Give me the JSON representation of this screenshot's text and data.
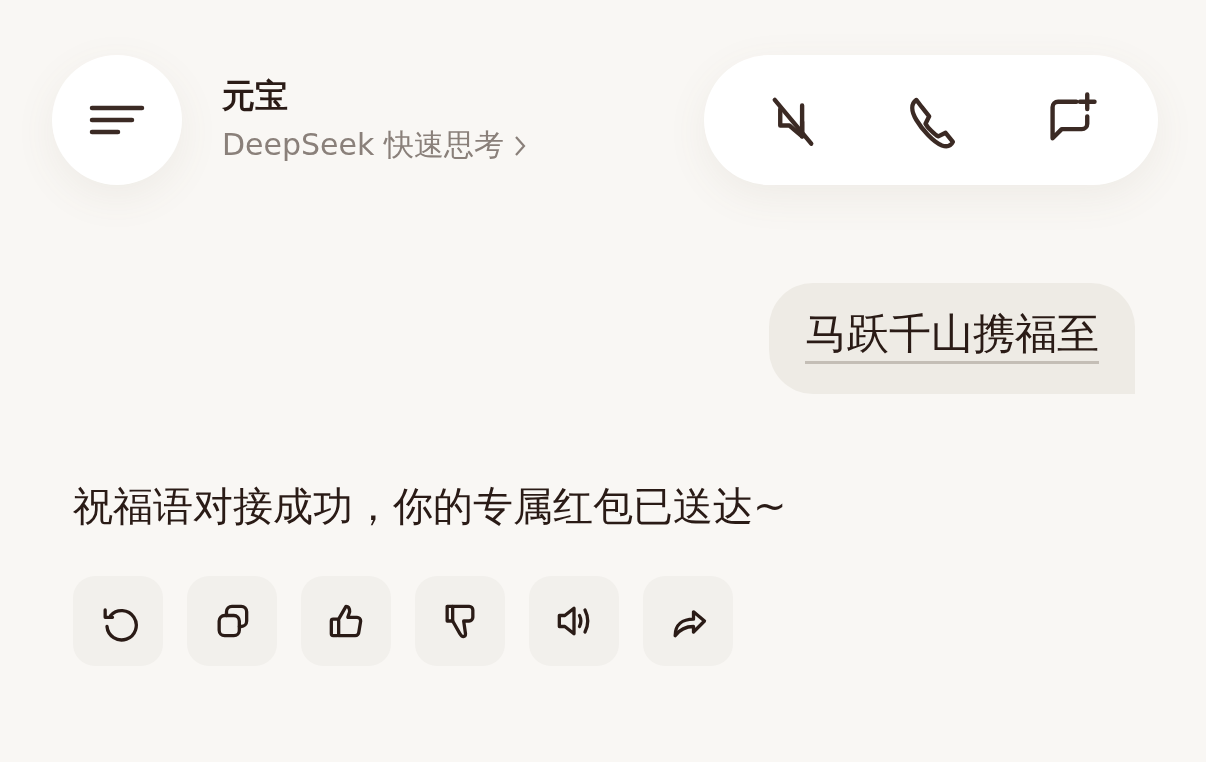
{
  "header": {
    "title": "元宝",
    "subtitle": "DeepSeek 快速思考",
    "actions": [
      {
        "kind": "mute"
      },
      {
        "kind": "call"
      },
      {
        "kind": "new-chat"
      }
    ]
  },
  "messages": [
    {
      "kind": "user",
      "text": "马跃千山携福至"
    },
    {
      "kind": "assistant",
      "text": "祝福语对接成功，你的专属红包已送达~",
      "actions": [
        {
          "kind": "regenerate"
        },
        {
          "kind": "copy"
        },
        {
          "kind": "like"
        },
        {
          "kind": "dislike"
        },
        {
          "kind": "read-aloud"
        },
        {
          "kind": "share"
        }
      ]
    }
  ]
}
